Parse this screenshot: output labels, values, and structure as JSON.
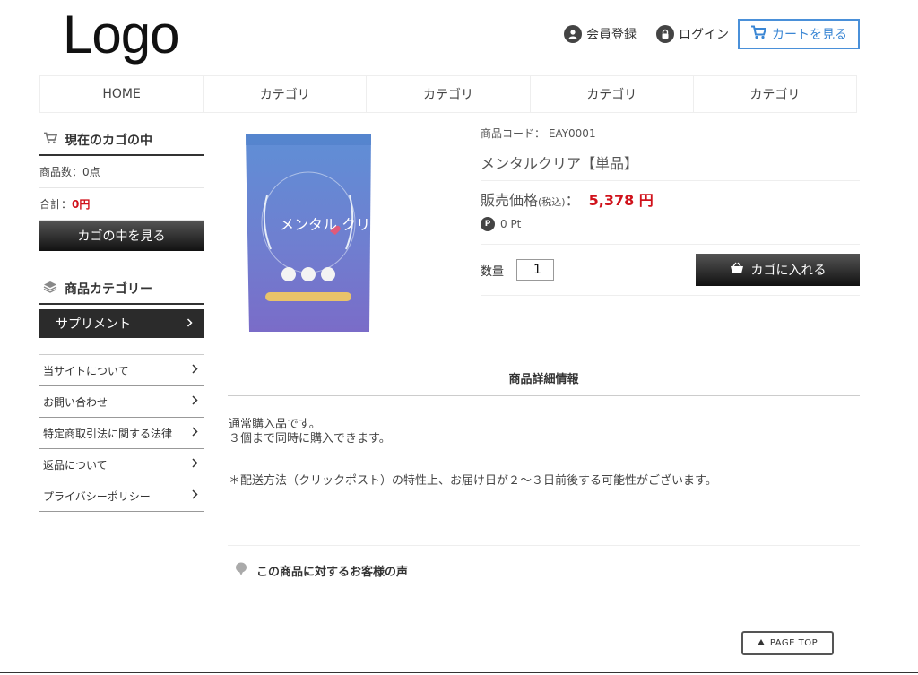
{
  "header": {
    "logo": "Logo",
    "register": "会員登録",
    "login": "ログイン",
    "cart": "カートを見る"
  },
  "nav": [
    "HOME",
    "カテゴリ",
    "カテゴリ",
    "カテゴリ",
    "カテゴリ"
  ],
  "sidebar": {
    "cart_title": "現在のカゴの中",
    "item_count": "商品数：0点",
    "total_label": "合計：",
    "total_value": "0円",
    "view_cart": "カゴの中を見る",
    "category_title": "商品カテゴリー",
    "category_item": "サプリメント",
    "links": [
      "当サイトについて",
      "お問い合わせ",
      "特定商取引法に関する法律",
      "返品について",
      "プライバシーポリシー"
    ]
  },
  "product": {
    "code_label": "商品コード：",
    "code": "EAY0001",
    "name": "メンタルクリア【単品】",
    "price_label": "販売価格",
    "tax_label": "(税込)",
    "price_sep": "：",
    "price": "5,378 円",
    "points": "0 Pt",
    "qty_label": "数量",
    "qty_value": "1",
    "add_to_cart": "カゴに入れる",
    "package_text": "メンタル クリア"
  },
  "detail": {
    "title": "商品詳細情報",
    "line1": "通常購入品です。",
    "line2": "３個まで同時に購入できます。",
    "note": "＊配送方法（クリックポスト）の特性上、お届け日が２～３日前後する可能性がございます。"
  },
  "reviews": {
    "title": "この商品に対するお客様の声"
  },
  "pagetop": "PAGE TOP",
  "colors": {
    "price_red": "#d0121b",
    "cart_blue": "#3a86d4",
    "dark_button": "#222222"
  }
}
